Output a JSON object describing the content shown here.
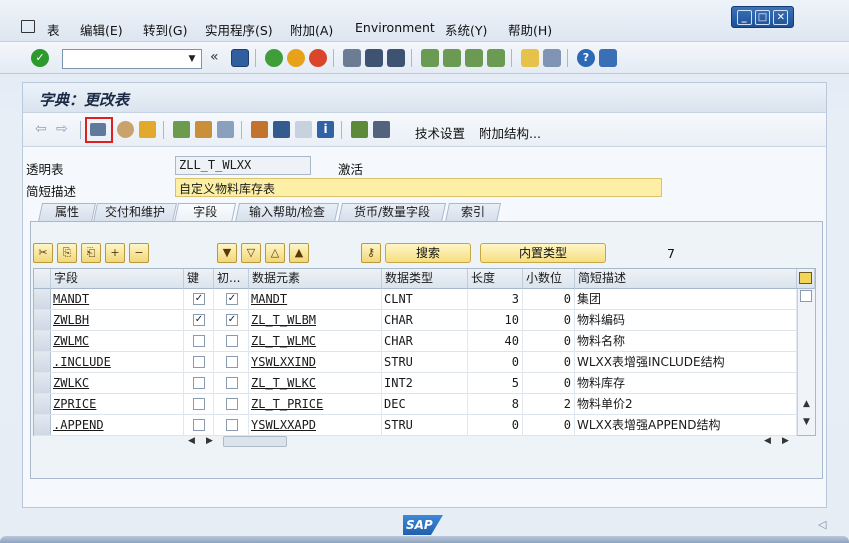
{
  "menu": {
    "items": [
      "表",
      "编辑(E)",
      "转到(G)",
      "实用程序(S)",
      "附加(A)",
      "Environment",
      "系统(Y)",
      "帮助(H)"
    ]
  },
  "window": {
    "minimize": "_",
    "restore": "□",
    "close": "✕"
  },
  "toolbar": {
    "command_value": ""
  },
  "page": {
    "title": "字典：更改表"
  },
  "app_toolbar": {
    "tech_settings": "技术设置",
    "append_structure": "附加结构..."
  },
  "fields": {
    "transparent_table_label": "透明表",
    "transparent_table_value": "ZLL_T_WLXX",
    "status": "激活",
    "short_desc_label": "简短描述",
    "short_desc_value": "自定义物料库存表"
  },
  "tabs": [
    "属性",
    "交付和维护",
    "字段",
    "输入帮助/检查",
    "货币/数量字段",
    "索引"
  ],
  "active_tab": "字段",
  "table_controls": {
    "search_label": "搜索",
    "builtin_type_label": "内置类型",
    "row_count": "7"
  },
  "table": {
    "columns": [
      "字段",
      "键",
      "初...",
      "数据元素",
      "数据类型",
      "长度",
      "小数位",
      "简短描述"
    ],
    "rows": [
      {
        "field": "MANDT",
        "key": true,
        "init": true,
        "element": "MANDT",
        "type": "CLNT",
        "length": "3",
        "decimals": "0",
        "desc": "集团"
      },
      {
        "field": "ZWLBH",
        "key": true,
        "init": true,
        "element": "ZL_T_WLBM",
        "type": "CHAR",
        "length": "10",
        "decimals": "0",
        "desc": "物料编码"
      },
      {
        "field": "ZWLMC",
        "key": false,
        "init": false,
        "element": "ZL_T_WLMC",
        "type": "CHAR",
        "length": "40",
        "decimals": "0",
        "desc": "物料名称"
      },
      {
        "field": ".INCLUDE",
        "key": false,
        "init": false,
        "element": "YSWLXXIND",
        "type": "STRU",
        "length": "0",
        "decimals": "0",
        "desc": "WLXX表增强INCLUDE结构"
      },
      {
        "field": "ZWLKC",
        "key": false,
        "init": false,
        "element": "ZL_T_WLKC",
        "type": "INT2",
        "length": "5",
        "decimals": "0",
        "desc": "物料库存"
      },
      {
        "field": "ZPRICE",
        "key": false,
        "init": false,
        "element": "ZL_T_PRICE",
        "type": "DEC",
        "length": "8",
        "decimals": "2",
        "desc": "物料单价2"
      },
      {
        "field": ".APPEND",
        "key": false,
        "init": false,
        "element": "YSWLXXAPD",
        "type": "STRU",
        "length": "0",
        "decimals": "0",
        "desc": "WLXX表增强APPEND结构"
      }
    ]
  },
  "footer": {
    "logo_text": "SAP"
  },
  "colors": {
    "accent": "#1d4f97",
    "yellow_field": "#fdf0a6",
    "highlight_box": "#e02020"
  }
}
